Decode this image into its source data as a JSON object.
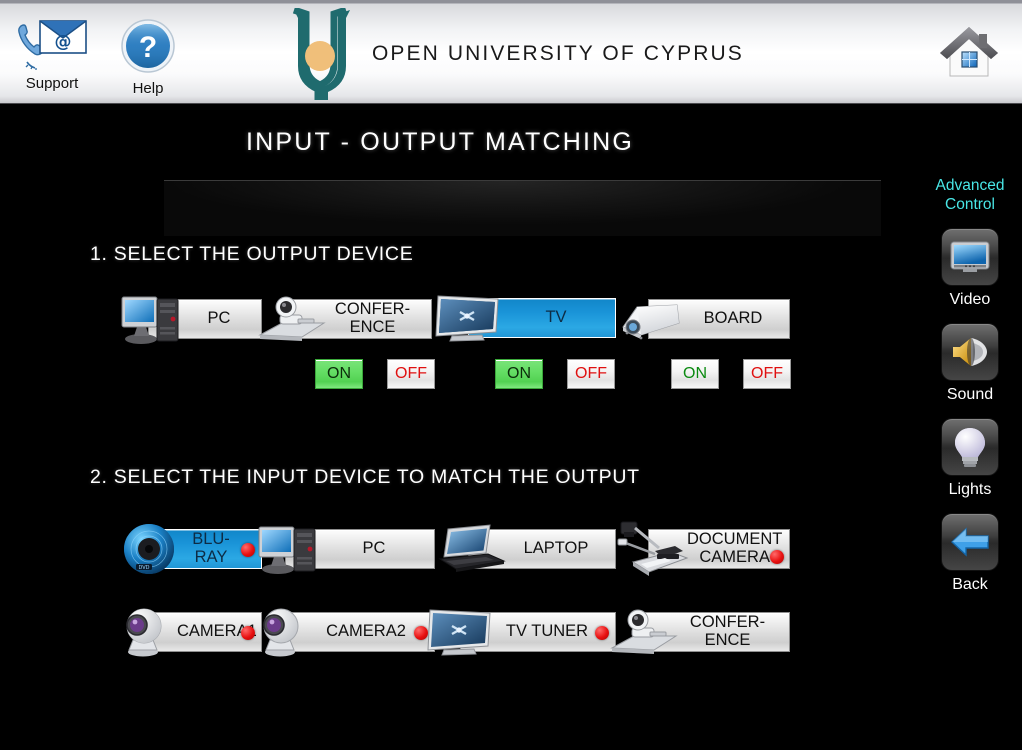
{
  "header": {
    "brand_title": "OPEN UNIVERSITY OF CYPRUS",
    "support_label": "Support",
    "help_label": "Help",
    "support_icon": "phone-envelope-icon",
    "help_icon": "question-mark-circle-icon",
    "logo_icon": "open-university-of-cyprus-logo",
    "home_icon": "home-icon"
  },
  "page": {
    "title": "INPUT - OUTPUT MATCHING"
  },
  "sections": {
    "output": {
      "heading": "1. SELECT THE OUTPUT DEVICE",
      "devices": [
        {
          "label": "PC",
          "icon": "desktop-computer-icon",
          "selected": false,
          "power": null
        },
        {
          "label": "CONFER-\nENCE",
          "icon": "conference-camera-icon",
          "selected": false,
          "power": "ON"
        },
        {
          "label": "TV",
          "icon": "tv-screen-icon",
          "selected": true,
          "power": "ON"
        },
        {
          "label": "BOARD",
          "icon": "projector-icon",
          "selected": false,
          "power": null
        }
      ],
      "power_labels": {
        "on": "ON",
        "off": "OFF"
      }
    },
    "input": {
      "heading": "2. SELECT THE INPUT DEVICE TO MATCH THE OUTPUT",
      "devices": [
        {
          "label": "BLU-RAY",
          "icon": "bluray-disc-icon",
          "selected": true,
          "dot": true
        },
        {
          "label": "PC",
          "icon": "desktop-computer-icon",
          "selected": false,
          "dot": false
        },
        {
          "label": "LAPTOP",
          "icon": "laptop-icon",
          "selected": false,
          "dot": false
        },
        {
          "label": "DOCUMENT\nCAMERA",
          "icon": "document-camera-icon",
          "selected": false,
          "dot": true
        },
        {
          "label": "CAMERA1",
          "icon": "dome-camera-icon",
          "selected": false,
          "dot": true
        },
        {
          "label": "CAMERA2",
          "icon": "dome-camera-icon",
          "selected": false,
          "dot": true
        },
        {
          "label": "TV TUNER",
          "icon": "tv-screen-icon",
          "selected": false,
          "dot": true
        },
        {
          "label": "CONFER-\nENCE",
          "icon": "conference-camera-icon",
          "selected": false,
          "dot": false
        }
      ]
    }
  },
  "sidebar": {
    "group_label": "Advanced\nControl",
    "items": [
      {
        "label": "Video",
        "icon": "video-monitor-icon"
      },
      {
        "label": "Sound",
        "icon": "speaker-icon"
      },
      {
        "label": "Lights",
        "icon": "light-bulb-icon"
      },
      {
        "label": "Back",
        "icon": "arrow-left-icon"
      }
    ]
  },
  "colors": {
    "selected_blue": "#1a94d8",
    "on_green": "#63dd63",
    "off_red": "#e01010",
    "accent_cyan": "#49e6e6",
    "logo_teal": "#1f6b6e",
    "logo_orange": "#f0bf7a",
    "indicator_red": "#e81010"
  }
}
